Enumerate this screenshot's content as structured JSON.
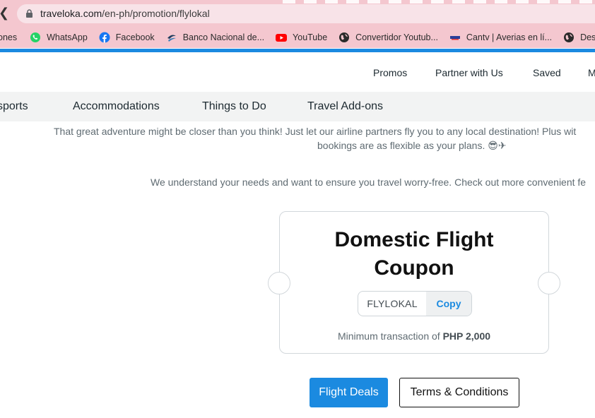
{
  "browser": {
    "url_host": "traveloka.com",
    "url_path": "/en-ph/promotion/flylokal",
    "bookmarks": [
      {
        "label": "ones",
        "icon": "folder-icon"
      },
      {
        "label": "WhatsApp",
        "icon": "whatsapp-icon"
      },
      {
        "label": "Facebook",
        "icon": "facebook-icon"
      },
      {
        "label": "Banco Nacional de...",
        "icon": "bank-icon"
      },
      {
        "label": "YouTube",
        "icon": "youtube-icon"
      },
      {
        "label": "Convertidor Youtub...",
        "icon": "globe-icon"
      },
      {
        "label": "Cantv | Averias en lí...",
        "icon": "cantv-icon"
      },
      {
        "label": "Descargar l",
        "icon": "globe-icon"
      }
    ]
  },
  "header": {
    "nav": [
      "Promos",
      "Partner with Us",
      "Saved",
      "M"
    ]
  },
  "categories": [
    "sports",
    "Accommodations",
    "Things to Do",
    "Travel Add-ons"
  ],
  "content": {
    "intro_line1": "That great adventure might be closer than you think! Just let our airline partners fly you to any local destination! Plus wit",
    "intro_line2": "bookings are as flexible as your plans. 😎✈",
    "intro_line3": "We understand your needs and want to ensure you travel worry-free. Check out more convenient fe"
  },
  "coupon": {
    "title_line1": "Domestic Flight",
    "title_line2": "Coupon",
    "code": "FLYLOKAL",
    "copy_label": "Copy",
    "min_prefix": "Minimum transaction of",
    "min_amount": "PHP 2,000"
  },
  "actions": {
    "primary_label": "Flight Deals",
    "secondary_label": "Terms & Conditions"
  },
  "colors": {
    "accent": "#1b8ae0",
    "chrome": "#f4c7cf"
  }
}
